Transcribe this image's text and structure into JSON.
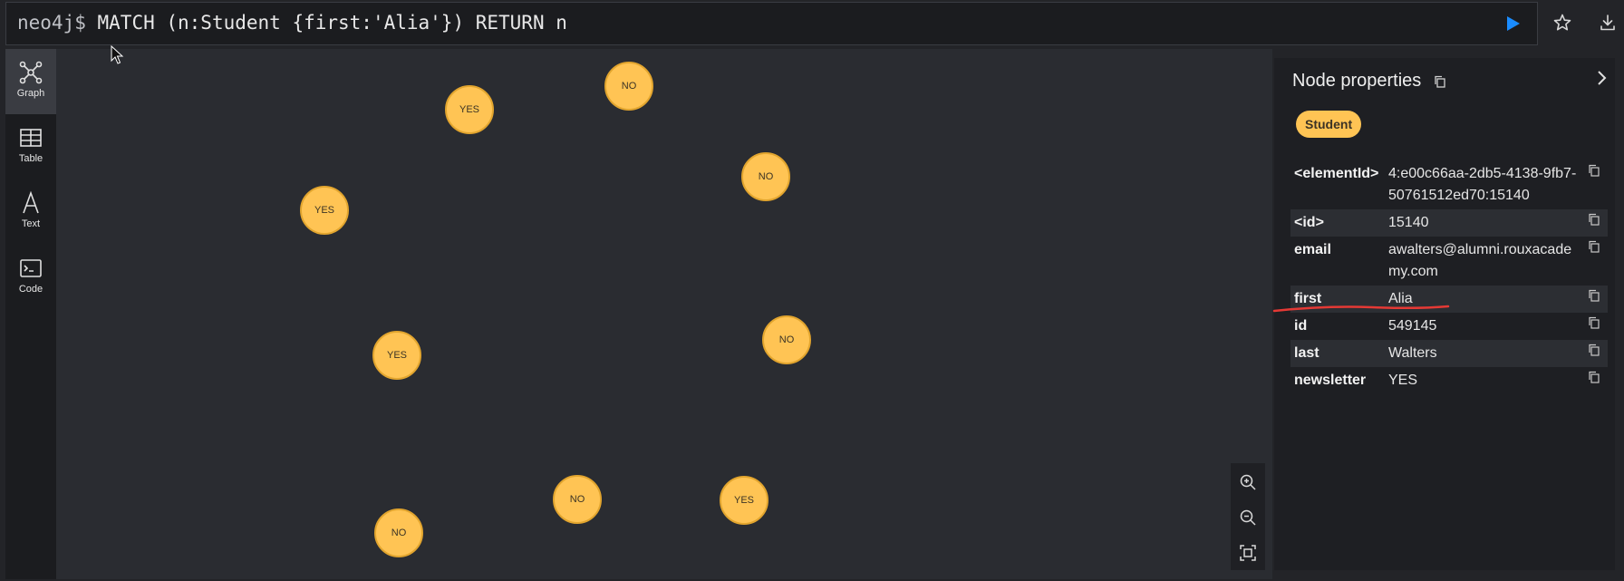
{
  "query": {
    "prompt": "neo4j$",
    "text": "MATCH (n:Student {first:'Alia'}) RETURN n"
  },
  "toolbar": {
    "run_icon": "play-icon",
    "favorite_icon": "star-icon",
    "download_icon": "download-icon",
    "accent": "#1a8cff"
  },
  "sidenav": {
    "items": [
      {
        "label": "Graph",
        "icon": "graph-icon"
      },
      {
        "label": "Table",
        "icon": "table-icon"
      },
      {
        "label": "Text",
        "icon": "text-icon"
      },
      {
        "label": "Code",
        "icon": "code-icon"
      }
    ]
  },
  "graph": {
    "node_color": "#ffc454",
    "nodes": [
      {
        "caption": "YES"
      },
      {
        "caption": "NO"
      },
      {
        "caption": "NO"
      },
      {
        "caption": "YES"
      },
      {
        "caption": "YES"
      },
      {
        "caption": "NO"
      },
      {
        "caption": "NO"
      },
      {
        "caption": "YES"
      },
      {
        "caption": "NO"
      }
    ]
  },
  "zoom": {
    "zoom_in_icon": "zoom-in-icon",
    "zoom_out_icon": "zoom-out-icon",
    "fit_icon": "fit-to-screen-icon"
  },
  "panel": {
    "title": "Node properties",
    "label": "Student",
    "properties": [
      {
        "key": "<elementId>",
        "value": "4:e00c66aa-2db5-4138-9fb7-50761512ed70:15140"
      },
      {
        "key": "<id>",
        "value": "15140"
      },
      {
        "key": "email",
        "value": "awalters@alumni.rouxacademy.com"
      },
      {
        "key": "first",
        "value": "Alia"
      },
      {
        "key": "id",
        "value": "549145"
      },
      {
        "key": "last",
        "value": "Walters"
      },
      {
        "key": "newsletter",
        "value": "YES"
      }
    ],
    "annotation_color": "#e53935"
  }
}
